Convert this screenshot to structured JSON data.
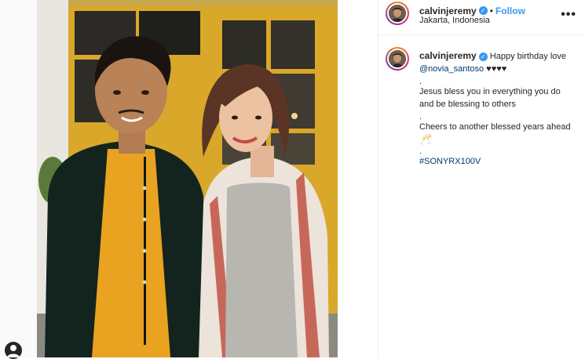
{
  "post": {
    "author": {
      "username": "calvinjeremy",
      "location": "Jakarta, Indonesia",
      "follow_label": "Follow",
      "dot": "•"
    },
    "more_label": "•••",
    "caption": {
      "username": "calvinjeremy",
      "text_1": "Happy birthday love",
      "mention": "@novia_santoso",
      "hearts": "♥♥♥♥",
      "dot": ".",
      "line_2a": "Jesus bless you in everything you do",
      "line_2b": "and be blessing to others",
      "line_3": "Cheers to another blessed years ahead",
      "emoji": "🥂",
      "hashtag": "#SONYRX100V"
    }
  },
  "colors": {
    "link": "#3897f0",
    "text": "#262626",
    "mention": "#00376b"
  }
}
